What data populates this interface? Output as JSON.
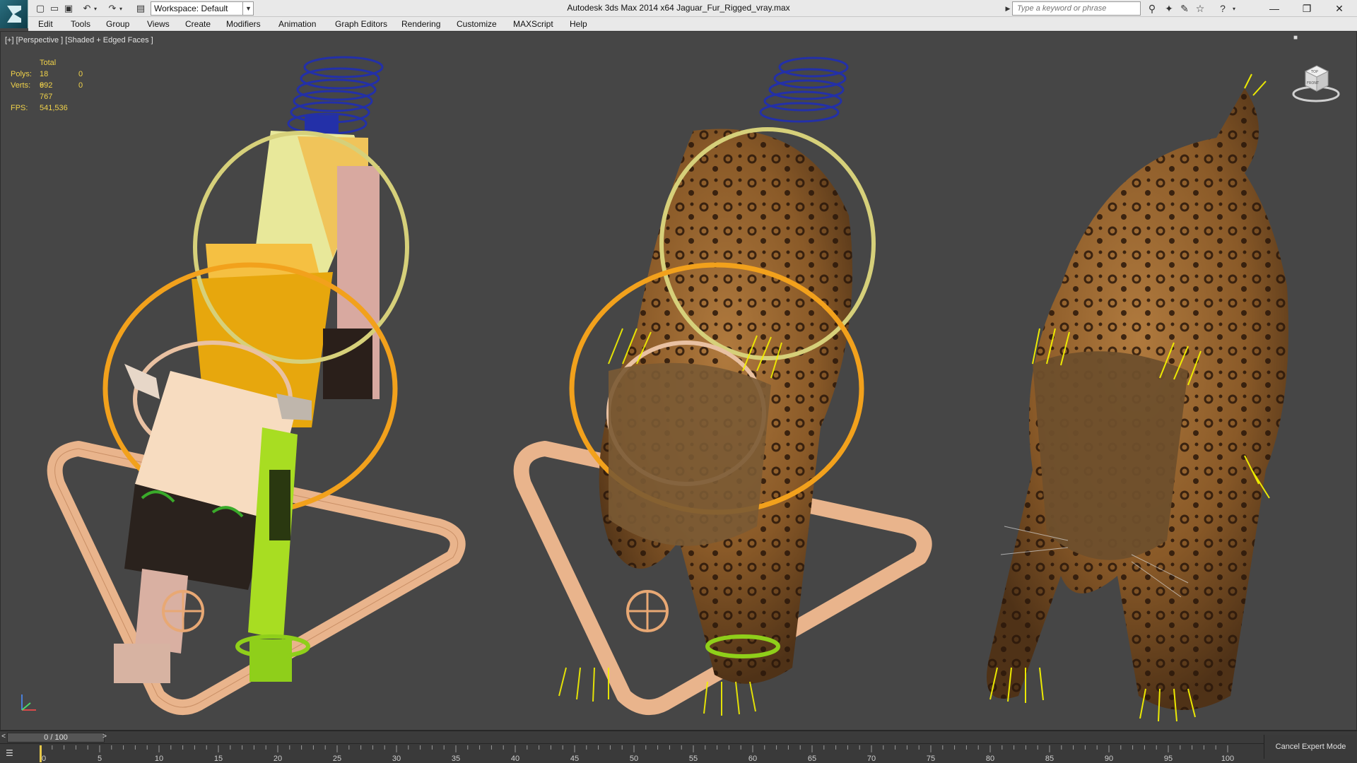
{
  "titlebar": {
    "workspace_label": "Workspace: Default",
    "window_title": "Autodesk 3ds Max  2014 x64     Jaguar_Fur_Rigged_vray.max",
    "search_placeholder": "Type a keyword or phrase"
  },
  "menubar": {
    "items": [
      "Edit",
      "Tools",
      "Group",
      "Views",
      "Create",
      "Modifiers",
      "Animation",
      "Graph Editors",
      "Rendering",
      "Customize",
      "MAXScript",
      "Help"
    ]
  },
  "viewport": {
    "label": "[+] [Perspective ] [Shaded + Edged Faces ]",
    "stats": {
      "header": "Total",
      "polys_label": "Polys:",
      "polys_value": "18 692",
      "polys_sel": "0",
      "verts_label": "Verts:",
      "verts_value": "9 767",
      "verts_sel": "0",
      "fps_label": "FPS:",
      "fps_value": "541,536"
    },
    "viewcube": {
      "top": "TOP",
      "front": "FRONT"
    }
  },
  "timeline": {
    "slider_label": "0 / 100",
    "prev_arrow": "<",
    "next_arrow": ">",
    "ticks": [
      "0",
      "5",
      "10",
      "15",
      "20",
      "25",
      "30",
      "35",
      "40",
      "45",
      "50",
      "55",
      "60",
      "65",
      "70",
      "75",
      "80",
      "85",
      "90",
      "95",
      "100"
    ],
    "current_frame": 0
  },
  "statusbar": {
    "cancel_expert": "Cancel Expert Mode"
  },
  "colors": {
    "viewport_bg": "#464646",
    "stats_text": "#f0d24a",
    "ui_light": "#e9e9e9"
  }
}
